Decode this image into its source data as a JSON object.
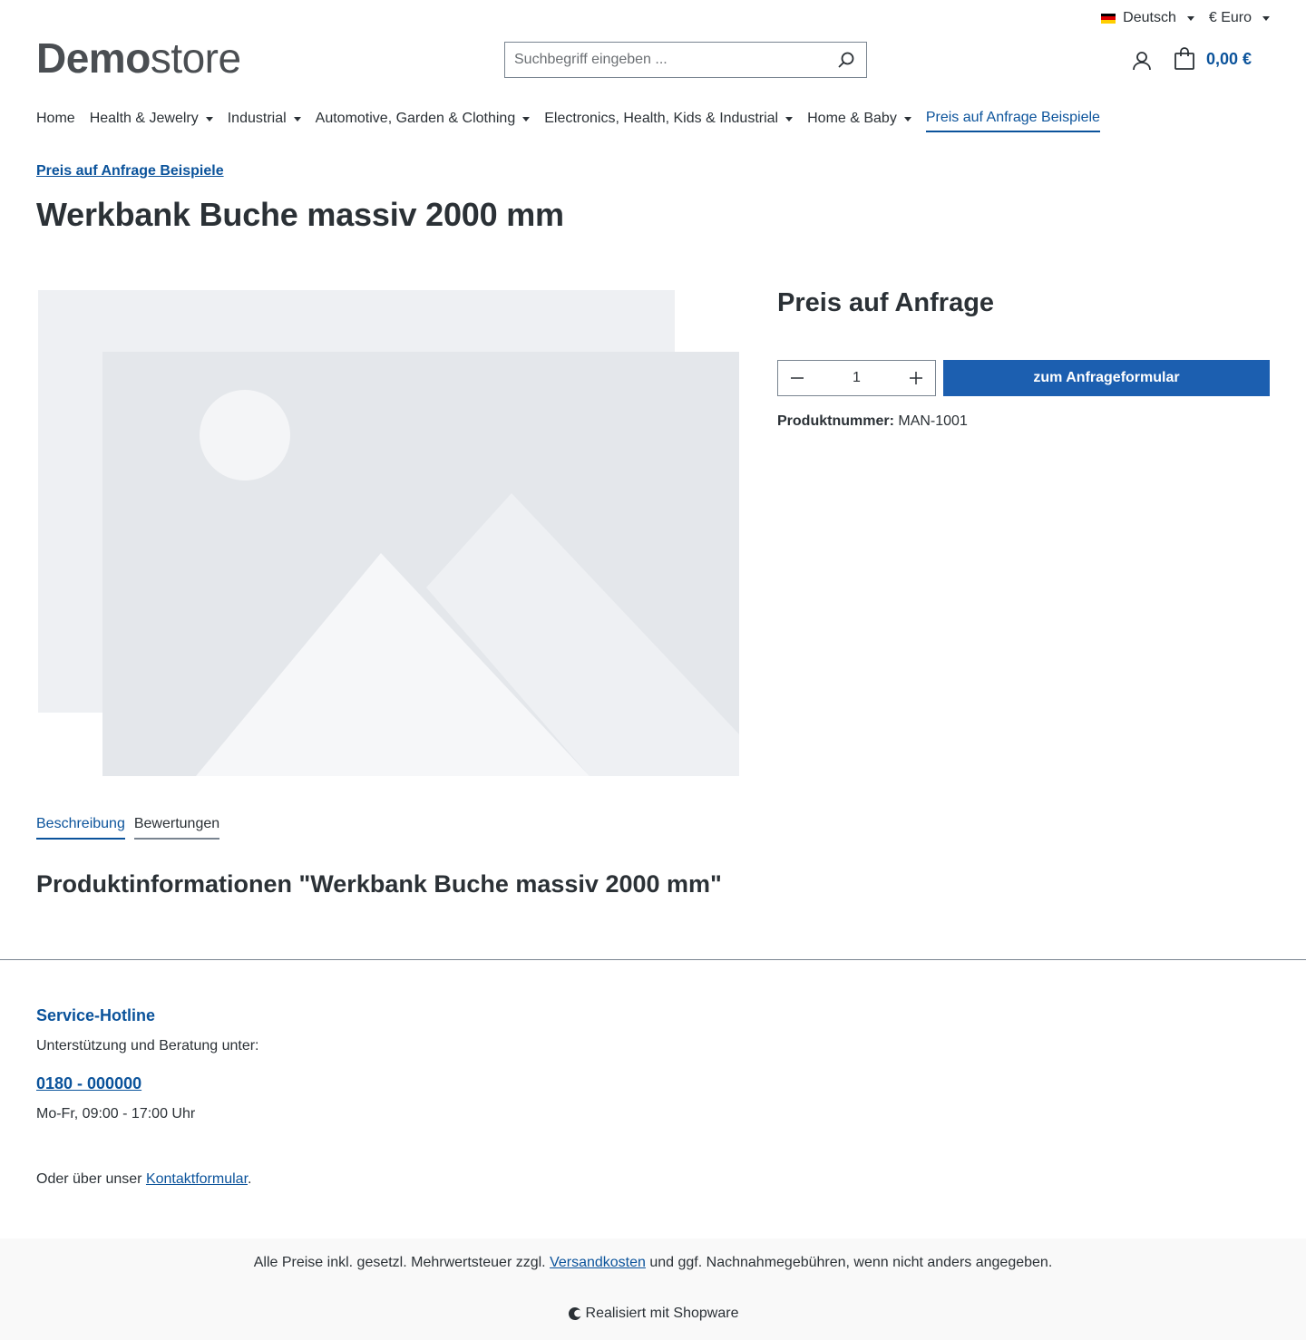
{
  "topbar": {
    "language": "Deutsch",
    "currency": "€ Euro"
  },
  "header": {
    "logo_bold": "Demo",
    "logo_light": "store",
    "search_placeholder": "Suchbegriff eingeben ...",
    "cart_total": "0,00 €"
  },
  "nav": {
    "items": [
      {
        "label": "Home"
      },
      {
        "label": "Health & Jewelry"
      },
      {
        "label": "Industrial"
      },
      {
        "label": "Automotive, Garden & Clothing"
      },
      {
        "label": "Electronics, Health, Kids & Industrial"
      },
      {
        "label": "Home & Baby"
      },
      {
        "label": "Preis auf Anfrage Beispiele"
      }
    ]
  },
  "breadcrumb": "Preis auf Anfrage Beispiele",
  "product": {
    "title": "Werkbank Buche massiv 2000 mm",
    "price": "Preis auf Anfrage",
    "quantity": "1",
    "cta": "zum Anfrageformular",
    "number_label": "Produktnummer:",
    "number_value": "MAN-1001"
  },
  "tabs": [
    {
      "label": "Beschreibung"
    },
    {
      "label": "Bewertungen"
    }
  ],
  "description_title": "Produktinformationen \"Werkbank Buche massiv 2000 mm\"",
  "footer": {
    "hotline_title": "Service-Hotline",
    "hotline_sub": "Unterstützung und Beratung unter:",
    "phone": "0180 - 000000",
    "hours": "Mo-Fr, 09:00 - 17:00 Uhr",
    "contact_prefix": "Oder über unser ",
    "contact_link": "Kontaktformular",
    "contact_suffix": ".",
    "vat_prefix": "Alle Preise inkl. gesetzl. Mehrwertsteuer zzgl. ",
    "vat_link": "Versandkosten",
    "vat_suffix": " und ggf. Nachnahmegebühren, wenn nicht anders angegeben.",
    "powered": "Realisiert mit Shopware"
  },
  "colors": {
    "accent": "#0b539b",
    "button": "#1c5fb0",
    "text": "#2b3136"
  }
}
